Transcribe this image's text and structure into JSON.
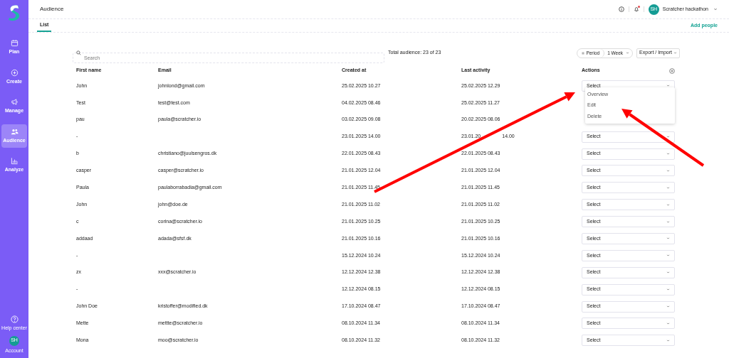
{
  "sidebar": {
    "items": [
      {
        "label": "Plan",
        "selected": false
      },
      {
        "label": "Create",
        "selected": false
      },
      {
        "label": "Manage",
        "selected": false
      },
      {
        "label": "Audience",
        "selected": true
      },
      {
        "label": "Analyze",
        "selected": false
      }
    ],
    "help": {
      "label": "Help center"
    },
    "account": {
      "initials": "SH",
      "label": "Account"
    }
  },
  "header": {
    "title": "Audience",
    "user": {
      "initials": "SH",
      "name": "Scratcher hackathon"
    },
    "notification_dot": true
  },
  "tabs": [
    {
      "label": "List",
      "selected": true
    }
  ],
  "add_people": "Add people",
  "search": {
    "placeholder": "Search"
  },
  "total": "Total audience: 23 of 23",
  "period": {
    "label": "Period",
    "value": "1 Week"
  },
  "export": "Export / Import",
  "table": {
    "columns": [
      "First name",
      "Email",
      "Created at",
      "Last activity",
      "Actions"
    ],
    "rows": [
      {
        "first_name": "John",
        "email": "johnlond@gmail.com",
        "created": "25.02.2025 10.27",
        "last": "25.02.2025 12.29",
        "action": "Select"
      },
      {
        "first_name": "Test",
        "email": "test@test.com",
        "created": "04.02.2025 08.46",
        "last": "25.02.2025 11.27"
      },
      {
        "first_name": "pau",
        "email": "paula@scratcher.io",
        "created": "03.02.2025 09.08",
        "last": "20.02.2025 08.06"
      },
      {
        "first_name": "-",
        "created": "23.01.2025 14.00",
        "last_parts": [
          "23.01.20",
          "14.00"
        ],
        "action": "Select"
      },
      {
        "first_name": "b",
        "email": "christiano@juulsengros.dk",
        "created": "22.01.2025 08.43",
        "last": "22.01.2025 08.43",
        "action": "Select"
      },
      {
        "first_name": "casper",
        "email": "casper@scratcher.io",
        "created": "21.01.2025 12.04",
        "last": "21.01.2025 12.04",
        "action": "Select"
      },
      {
        "first_name": "Paula",
        "email": "paulaborrabadia@gmail.com",
        "created": "21.01.2025 11.45",
        "last": "21.01.2025 11.45",
        "action": "Select"
      },
      {
        "first_name": "John",
        "email": "john@doe.de",
        "created": "21.01.2025 11.02",
        "last": "21.01.2025 11.02",
        "action": "Select"
      },
      {
        "first_name": "c",
        "email": "corina@scratcher.io",
        "created": "21.01.2025 10.25",
        "last": "21.01.2025 10.25",
        "action": "Select"
      },
      {
        "first_name": "addaad",
        "email": "adada@sfsf.dk",
        "created": "21.01.2025 10.16",
        "last": "21.01.2025 10.16",
        "action": "Select"
      },
      {
        "first_name": "-",
        "created": "15.12.2024 10.24",
        "last": "15.12.2024 10.24",
        "action": "Select"
      },
      {
        "first_name": "zx",
        "email": "xxx@scratcher.io",
        "created": "12.12.2024 12.38",
        "last": "12.12.2024 12.38",
        "action": "Select"
      },
      {
        "first_name": "-",
        "created": "12.12.2024 08.15",
        "last": "12.12.2024 08.15",
        "action": "Select"
      },
      {
        "first_name": "John Doe",
        "email": "kristoffer@modified.dk",
        "created": "17.10.2024 08.47",
        "last": "17.10.2024 08.47",
        "action": "Select"
      },
      {
        "first_name": "Mette",
        "email": "mettte@scratcher.io",
        "created": "08.10.2024 11.34",
        "last": "08.10.2024 11.34",
        "action": "Select"
      },
      {
        "first_name": "Mona",
        "email": "moo@scratcher.io",
        "created": "08.10.2024 11.32",
        "last": "08.10.2024 11.32",
        "action": "Select"
      }
    ]
  },
  "dropdown_menu": [
    "Overview",
    "Edit",
    "Delete"
  ],
  "annotations": [
    {
      "kind": "arrow"
    },
    {
      "kind": "arrow"
    }
  ]
}
